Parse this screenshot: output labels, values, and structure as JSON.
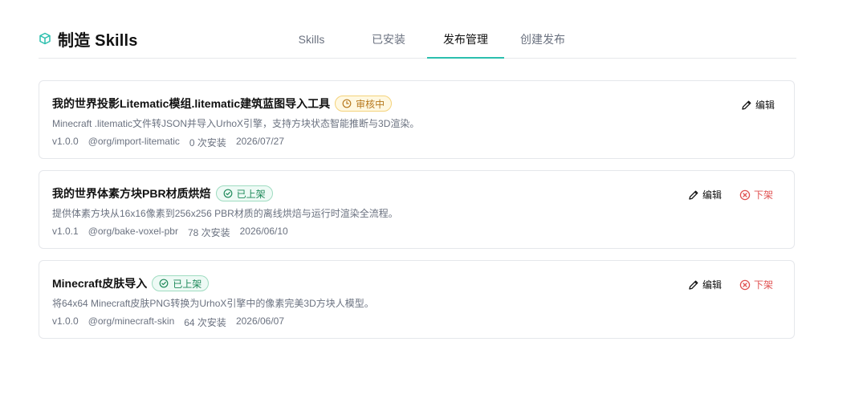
{
  "brand": {
    "title": "制造 Skills",
    "icon": "cube-icon",
    "accent": "#2bbfae"
  },
  "tabs": [
    {
      "label": "Skills",
      "active": false
    },
    {
      "label": "已安装",
      "active": false
    },
    {
      "label": "发布管理",
      "active": true
    },
    {
      "label": "创建发布",
      "active": false
    }
  ],
  "cards": [
    {
      "title": "我的世界投影Litematic模组.litematic建筑蓝图导入工具",
      "status": "审核中",
      "status_type": "review",
      "description": "Minecraft .litematic文件转JSON并导入UrhoX引擎，支持方块状态智能推断与3D渲染。",
      "version": "v1.0.0",
      "package": "@org/import-litematic",
      "installs": "0 次安装",
      "date": "2026/07/27",
      "edit_label": "编辑",
      "unlist_label": ""
    },
    {
      "title": "我的世界体素方块PBR材质烘焙",
      "status": "已上架",
      "status_type": "listed",
      "description": "提供体素方块从16x16像素到256x256 PBR材质的离线烘焙与运行时渲染全流程。",
      "version": "v1.0.1",
      "package": "@org/bake-voxel-pbr",
      "installs": "78 次安装",
      "date": "2026/06/10",
      "edit_label": "编辑",
      "unlist_label": "下架"
    },
    {
      "title": "Minecraft皮肤导入",
      "status": "已上架",
      "status_type": "listed",
      "description": "将64x64 Minecraft皮肤PNG转换为UrhoX引擎中的像素完美3D方块人模型。",
      "version": "v1.0.0",
      "package": "@org/minecraft-skin",
      "installs": "64 次安装",
      "date": "2026/06/07",
      "edit_label": "编辑",
      "unlist_label": "下架"
    }
  ],
  "colors": {
    "review": "#b7791f",
    "listed": "#1f8a5b",
    "unlist": "#e05252"
  }
}
